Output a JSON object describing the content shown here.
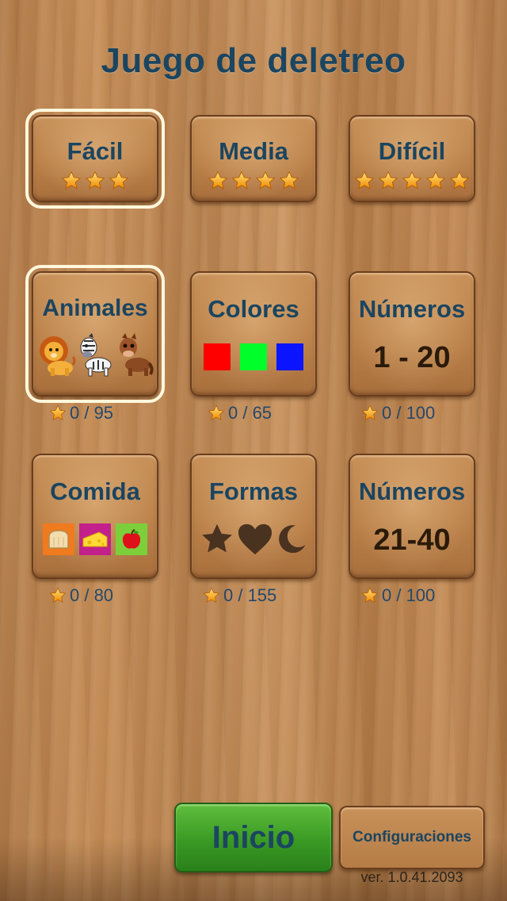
{
  "title": "Juego de deletreo",
  "levels": [
    {
      "label": "Fácil",
      "stars": 3,
      "selected": true
    },
    {
      "label": "Media",
      "stars": 4,
      "selected": false
    },
    {
      "label": "Difícil",
      "stars": 5,
      "selected": false
    }
  ],
  "categories": [
    {
      "label": "Animales",
      "score": "0 / 95",
      "selected": true
    },
    {
      "label": "Colores",
      "score": "0 / 65",
      "selected": false,
      "swatches": [
        "#ff0000",
        "#00ff2a",
        "#0a14ff"
      ]
    },
    {
      "label": "Números",
      "range": "1 - 20",
      "score": "0 / 100",
      "selected": false
    },
    {
      "label": "Comida",
      "score": "0 / 80",
      "selected": false
    },
    {
      "label": "Formas",
      "score": "0 / 155",
      "selected": false
    },
    {
      "label": "Números",
      "range": "21-40",
      "score": "0 / 100",
      "selected": false
    }
  ],
  "buttons": {
    "start": "Inicio",
    "settings": "Configuraciones"
  },
  "version": "ver. 1.0.41.2093",
  "colors": {
    "title": "#1b4560",
    "start_button": "#3a9a24",
    "selection_outline": "#fff7dc"
  }
}
